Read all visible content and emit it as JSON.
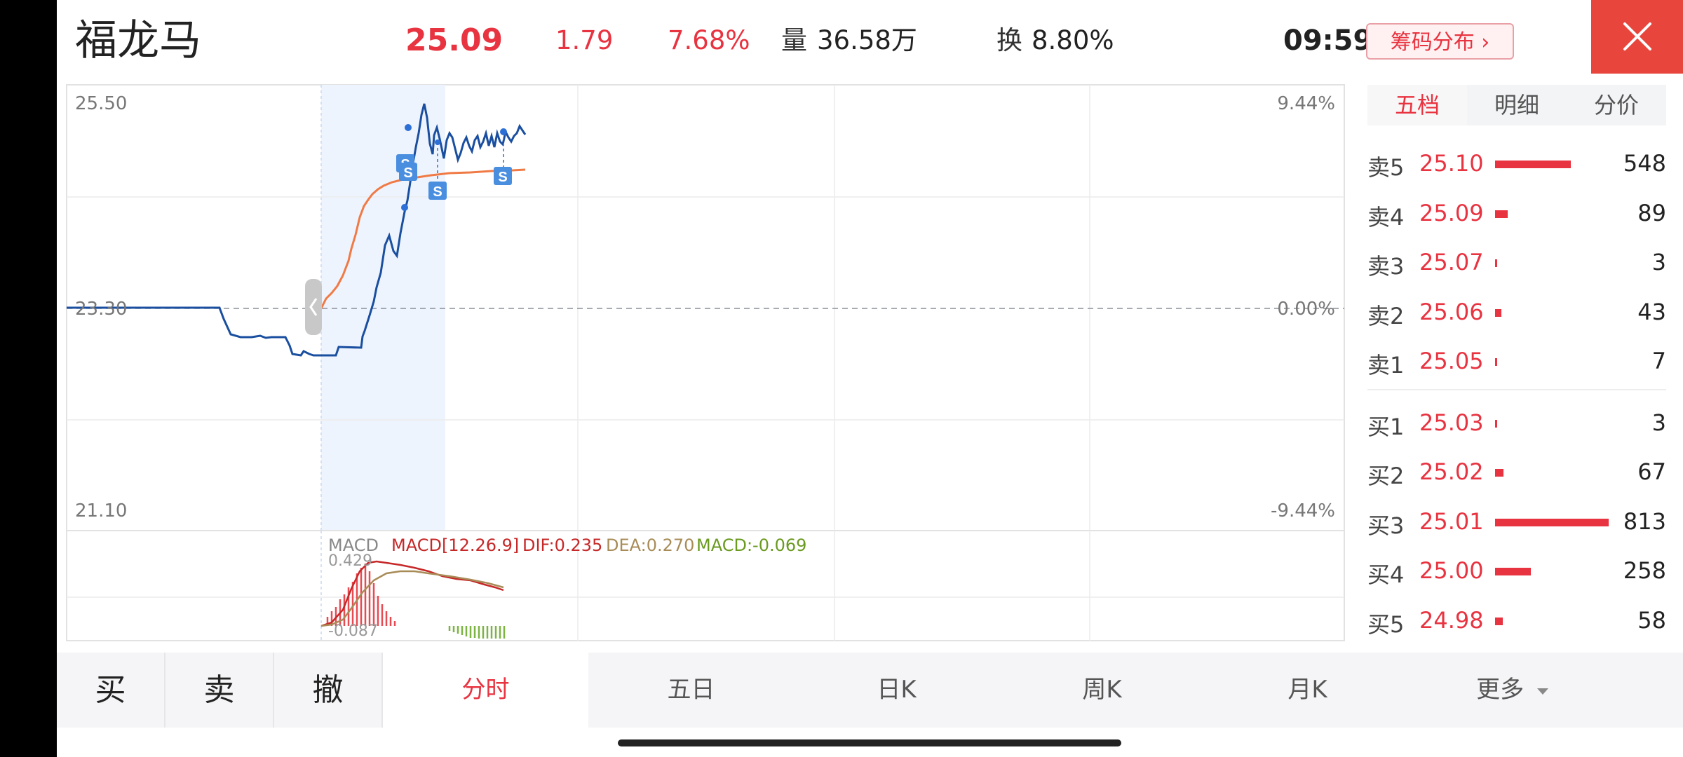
{
  "header": {
    "stock_name": "福龙马",
    "price": "25.09",
    "change": "1.79",
    "change_pct": "7.68%",
    "volume_label": "量",
    "volume": "36.58万",
    "turnover_label": "换",
    "turnover": "8.80%",
    "time": "09:59",
    "chip_button": "筹码分布 ›"
  },
  "chart": {
    "y_top": "25.50",
    "y_mid": "23.30",
    "y_bottom": "21.10",
    "pct_top": "9.44%",
    "pct_mid": "0.00%",
    "pct_bottom": "-9.44%",
    "sell_marker": "S"
  },
  "macd": {
    "title": "MACD",
    "params": "MACD[12.26.9]",
    "dif": "DIF:0.235",
    "dea": "DEA:0.270",
    "macd": "MACD:-0.069",
    "max_label": "0.429",
    "min_label": "-0.087"
  },
  "order_book": {
    "tabs": [
      "五档",
      "明细",
      "分价"
    ],
    "asks": [
      {
        "label": "卖5",
        "price": "25.10",
        "volume": "548"
      },
      {
        "label": "卖4",
        "price": "25.09",
        "volume": "89"
      },
      {
        "label": "卖3",
        "price": "25.07",
        "volume": "3"
      },
      {
        "label": "卖2",
        "price": "25.06",
        "volume": "43"
      },
      {
        "label": "卖1",
        "price": "25.05",
        "volume": "7"
      }
    ],
    "bids": [
      {
        "label": "买1",
        "price": "25.03",
        "volume": "3"
      },
      {
        "label": "买2",
        "price": "25.02",
        "volume": "67"
      },
      {
        "label": "买3",
        "price": "25.01",
        "volume": "813"
      },
      {
        "label": "买4",
        "price": "25.00",
        "volume": "258"
      },
      {
        "label": "买5",
        "price": "24.98",
        "volume": "58"
      }
    ]
  },
  "bottom": {
    "buy": "买",
    "sell": "卖",
    "cancel": "撤",
    "tabs": [
      "分时",
      "五日",
      "日K",
      "周K",
      "月K",
      "更多"
    ]
  },
  "colors": {
    "accent": "#e83340",
    "price_line": "#1a4fa0",
    "avg_line": "#f07a45",
    "macd_down": "#7cb342",
    "marker": "#4a8ee0"
  }
}
